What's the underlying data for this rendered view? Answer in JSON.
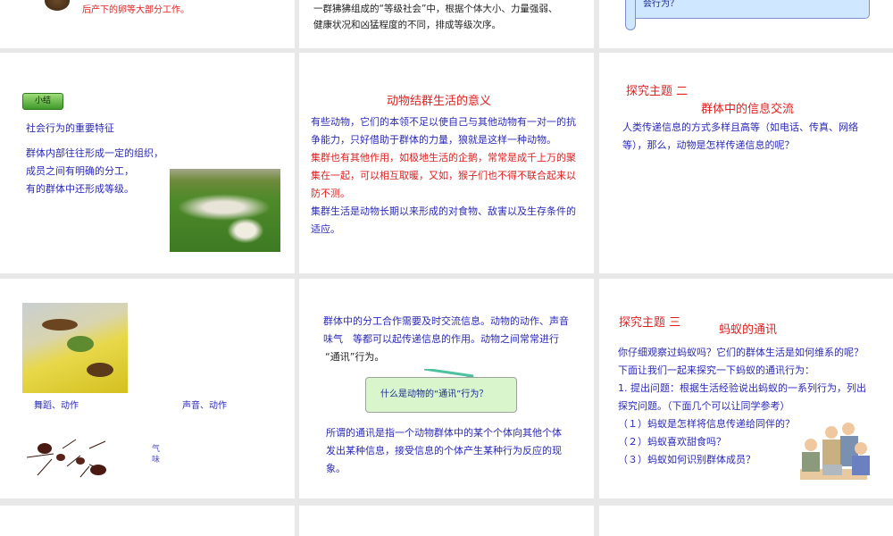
{
  "slides": [
    {
      "id": 1,
      "lines": [
        "后产下的卵等大部分工作。"
      ]
    },
    {
      "id": 2,
      "lines": [
        "一群狒狒组成的“等级社会”中，根据个体大小、力量强弱、",
        "健康状况和凶猛程度的不同，排成等级次序。"
      ]
    },
    {
      "id": 3,
      "lines": [
        "会行为？"
      ]
    },
    {
      "id": 4,
      "badge": "小结",
      "heading": "社会行为的重要特征",
      "lines": [
        "群体内部往往形成一定的组织，",
        "成员之间有明确的分工，",
        "有的群体中还形成等级。"
      ]
    },
    {
      "id": 5,
      "title": "动物结群生活的意义",
      "lines": [
        "有些动物，它们的本领不足以使自己与其他动物有一对一的抗",
        "争能力，只好借助于群体的力量，狼就是这样一种动物。"
      ],
      "red_lines": [
        "集群也有其他作用，如极地生活的企鹅，常常是成千上万的聚",
        "集在一起，可以相互取暖，又如，猴子们也不得不联合起来以",
        "防不测。"
      ],
      "lines2": [
        "集群生活是动物长期以来形成的对食物、敌害以及生存条件的",
        "适应。"
      ]
    },
    {
      "id": 6,
      "topic": "探究主题 二",
      "title": "群体中的信息交流",
      "lines": [
        "人类传递信息的方式多样且高等（如电话、传真、网络",
        "等），那么，动物是怎样传递信息的呢？"
      ]
    },
    {
      "id": 7,
      "label_dance": "舞蹈、动作",
      "label_sound": "声音、动作",
      "label_smell": [
        "气",
        "味"
      ]
    },
    {
      "id": 8,
      "lines": [
        "群体中的分工合作需要及时交流信息。动物的动作、声音",
        "味气　等都可以起传递信息的作用。动物之间常常进行",
        "“通讯”行为。"
      ],
      "scroll": "什么是动物的“通讯”行为？",
      "lines2": [
        "所谓的通讯是指一个动物群体中的某个个体向其他个体",
        "发出某种信息，接受信息的个体产生某种行为反应的现",
        "象。"
      ]
    },
    {
      "id": 9,
      "topic": "探究主题 三",
      "title": "蚂蚁的通讯",
      "lines": [
        "你仔细观察过蚂蚁吗？它们的群体生活是如何维系的呢？",
        "下面让我们一起来探究一下蚂蚁的通讯行为：",
        "1. 提出问题：根据生活经验说出蚂蚁的一系列行为，列出",
        "探究问题。（下面几个可以让同学参考）",
        "（１）蚂蚁是怎样将信息传递给同伴的？",
        "（２）蚂蚁喜欢甜食吗？",
        "（３）蚂蚁如何识别群体成员？"
      ]
    }
  ]
}
